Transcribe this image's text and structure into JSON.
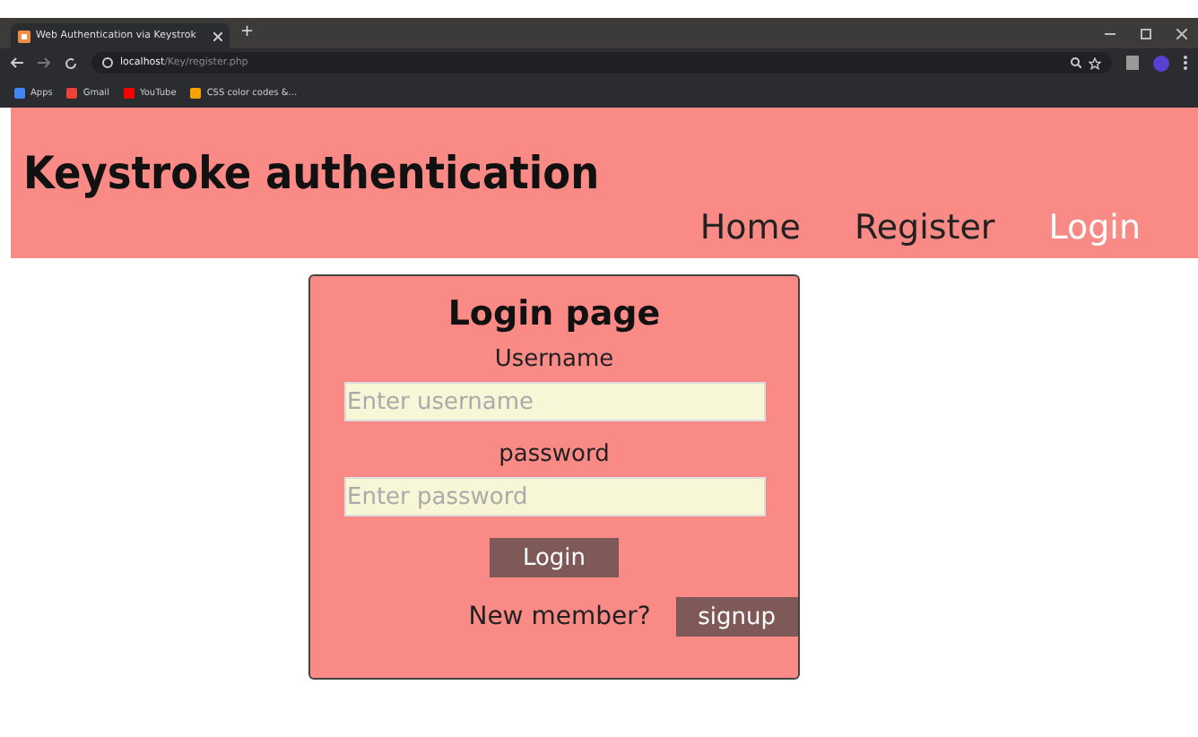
{
  "browser": {
    "tab_title": "Web Authentication via Keystrok",
    "new_tab": "+",
    "url_host": "localhost",
    "url_path": "/Key/register.php",
    "bookmarks": [
      "Apps",
      "Gmail",
      "YouTube",
      "CSS color codes &..."
    ]
  },
  "header": {
    "title": "Keystroke authentication",
    "nav": [
      {
        "label": "Home",
        "selected": false
      },
      {
        "label": "Register",
        "selected": false
      },
      {
        "label": "Login",
        "selected": true
      }
    ]
  },
  "form": {
    "title": "Login page",
    "fields": [
      {
        "label": "Username",
        "placeholder": "Enter username"
      },
      {
        "label": "password",
        "placeholder": "Enter password"
      }
    ],
    "submit": "Login",
    "new_member": "New member?",
    "signup": "signup"
  }
}
